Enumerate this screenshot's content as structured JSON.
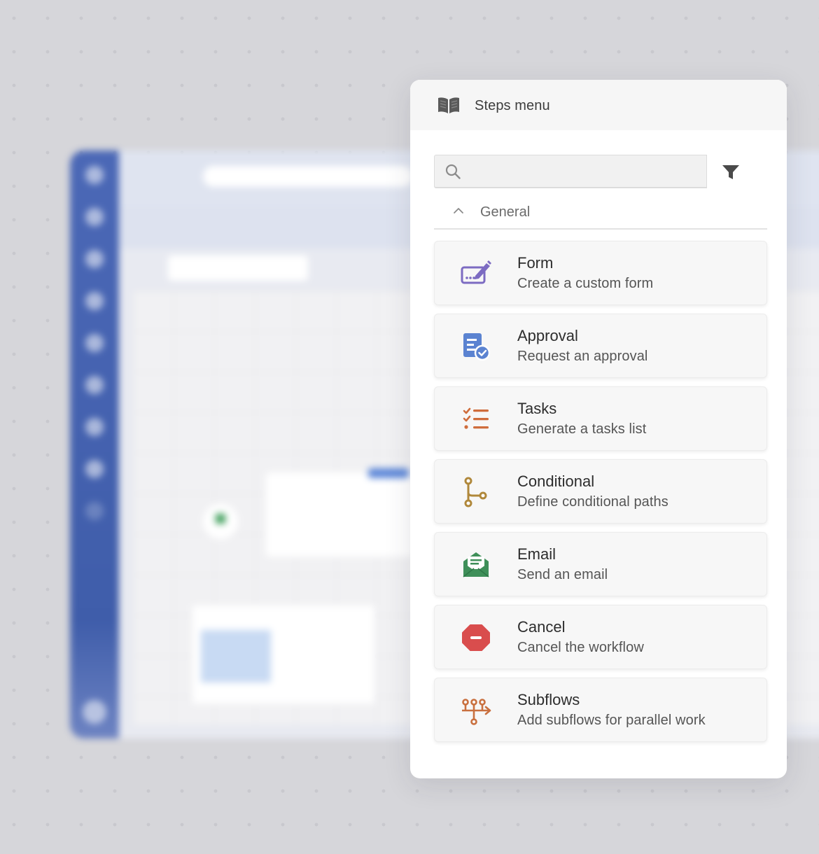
{
  "panel": {
    "title": "Steps menu",
    "header_icon": "book-icon"
  },
  "search": {
    "value": "",
    "placeholder": "",
    "icon": "search-icon",
    "filter_icon": "filter-icon"
  },
  "section": {
    "label": "General",
    "expanded": true,
    "icon": "chevron-up-icon"
  },
  "steps": [
    {
      "name": "Form",
      "description": "Create a custom form",
      "icon": "form-edit-icon",
      "color": "#7c6bc2"
    },
    {
      "name": "Approval",
      "description": "Request an approval",
      "icon": "approval-document-icon",
      "color": "#5b83d1"
    },
    {
      "name": "Tasks",
      "description": "Generate a tasks list",
      "icon": "task-list-icon",
      "color": "#cf6d3c"
    },
    {
      "name": "Conditional",
      "description": "Define conditional paths",
      "icon": "branch-icon",
      "color": "#b0883b"
    },
    {
      "name": "Email",
      "description": "Send an email",
      "icon": "email-open-icon",
      "color": "#3f8f59"
    },
    {
      "name": "Cancel",
      "description": "Cancel the workflow",
      "icon": "stop-icon",
      "color": "#d94d4d"
    },
    {
      "name": "Subflows",
      "description": "Add subflows for parallel work",
      "icon": "subflows-icon",
      "color": "#c9703f"
    }
  ]
}
